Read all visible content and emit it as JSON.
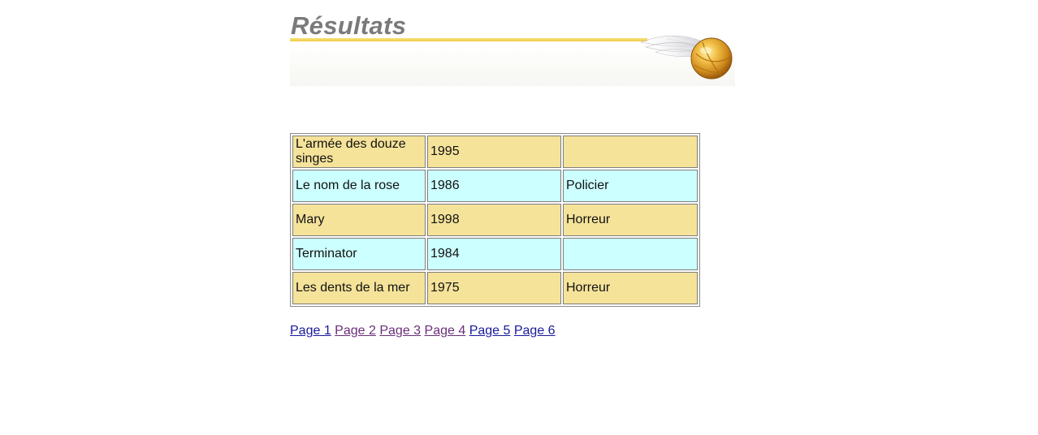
{
  "header": {
    "title": "Résultats"
  },
  "table": {
    "rows": [
      {
        "title": "L'armée des douze singes",
        "year": "1995",
        "genre": "",
        "style": "gold"
      },
      {
        "title": "Le nom de la rose",
        "year": "1986",
        "genre": "Policier",
        "style": "cyan"
      },
      {
        "title": "Mary",
        "year": "1998",
        "genre": "Horreur",
        "style": "gold"
      },
      {
        "title": "Terminator",
        "year": "1984",
        "genre": "",
        "style": "cyan"
      },
      {
        "title": "Les dents de la mer",
        "year": "1975",
        "genre": "Horreur",
        "style": "gold"
      }
    ]
  },
  "pagination": {
    "links": [
      {
        "label": "Page 1",
        "visited": false
      },
      {
        "label": "Page 2",
        "visited": true
      },
      {
        "label": "Page 3",
        "visited": true
      },
      {
        "label": "Page 4",
        "visited": true
      },
      {
        "label": "Page 5",
        "visited": false
      },
      {
        "label": "Page 6",
        "visited": false
      }
    ]
  },
  "colors": {
    "row_gold": "#f5e39a",
    "row_cyan": "#ccffff",
    "link": "#1a1a9c",
    "link_visited": "#6b2f7a",
    "title": "#7a7a7a",
    "accent_line": "#f0c840"
  },
  "icons": {
    "banner_decoration": "golden-snitch-icon"
  }
}
